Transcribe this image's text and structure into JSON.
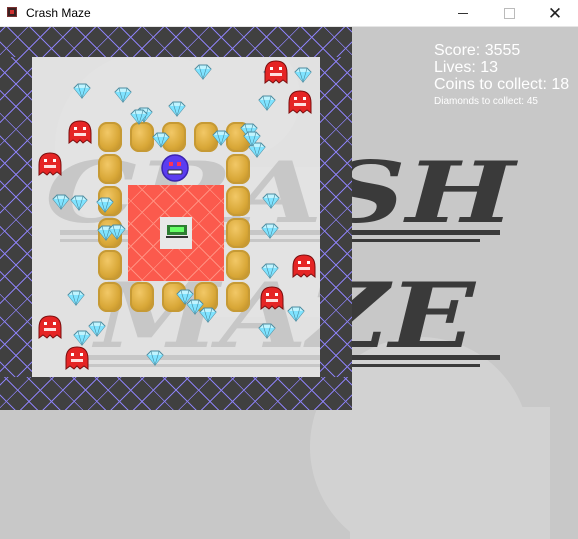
{
  "window": {
    "title": "Crash Maze"
  },
  "hud": {
    "score": "Score: 3555",
    "lives": "Lives: 13",
    "coins": "Coins to collect: 18",
    "diamonds": "Diamonds to collect: 45"
  },
  "logo": {
    "line1": "CRASH",
    "line2": "MAZE"
  },
  "icons": {
    "app": "app-icon",
    "minimize": "minimize-icon",
    "maximize": "maximize-icon",
    "close": "close-icon"
  },
  "colors": {
    "wall": "#404040",
    "wall_grid": "#8a7ff0",
    "hazard": "#fb5a4d",
    "coin": "#d9a838",
    "enemy": "#e52525",
    "player": "#5b3df0",
    "diamond": "#8ee8ff"
  }
}
